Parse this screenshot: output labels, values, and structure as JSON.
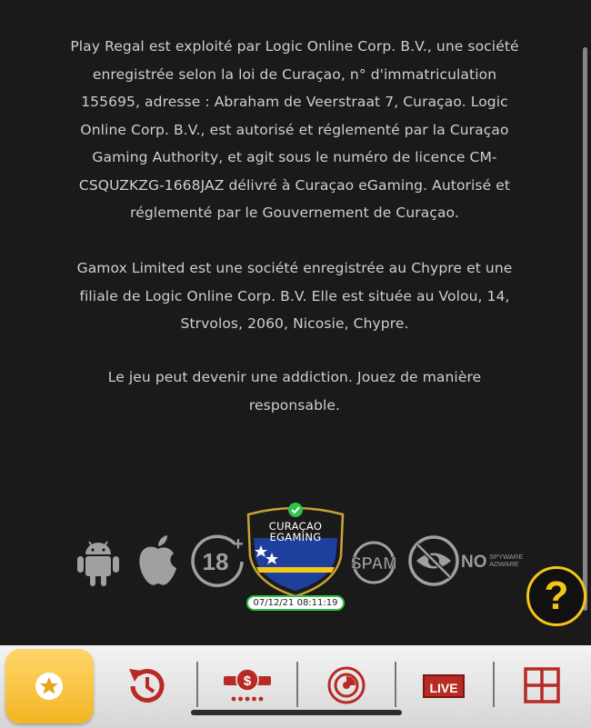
{
  "legal": {
    "paragraph1": [
      "Play Regal est exploité par Logic Online Corp. B.V., une société",
      "enregistrée selon la loi de Curaçao, n° d'immatriculation",
      "155695, adresse : Abraham de Veerstraat 7, Curaçao. Logic",
      "Online Corp. B.V., est autorisé et réglementé par la Curaçao",
      "Gaming Authority, et agit sous le numéro de licence CM-",
      "CSQUZKZG-1668JAZ délivré à Curaçao eGaming. Autorisé et",
      "réglementé par le Gouvernement de Curaçao."
    ],
    "paragraph2": [
      "Gamox Limited est une société enregistrée au Chypre et une",
      "filiale de Logic Online Corp. B.V. Elle est située au Volou, 14,",
      "Strvolos, 2060, Nicosie, Chypre."
    ],
    "paragraph3": [
      "Le jeu peut devenir une addiction. Jouez de manière",
      "responsable."
    ]
  },
  "badges": {
    "age": "18",
    "age_plus": "+",
    "curacao_line1": "CURAÇAO",
    "curacao_line2": "EGAMING",
    "curacao_date": "07/12/21  08:11:19",
    "spam": "SPAM",
    "no_text": "NO",
    "spyware": "SPYWARE",
    "adware": "ADWARE"
  },
  "help": {
    "label": "?"
  },
  "nav": {
    "live_label": "LIVE",
    "icons": [
      "star-icon",
      "history-icon",
      "cashback-icon",
      "casino-chip-icon",
      "live-icon",
      "grid-icon"
    ]
  },
  "colors": {
    "background": "#1a1a1a",
    "text": "#cfcfcf",
    "accent_yellow": "#f5c518",
    "nav_red": "#b82a24",
    "badge_gray": "#9a9a9a"
  }
}
